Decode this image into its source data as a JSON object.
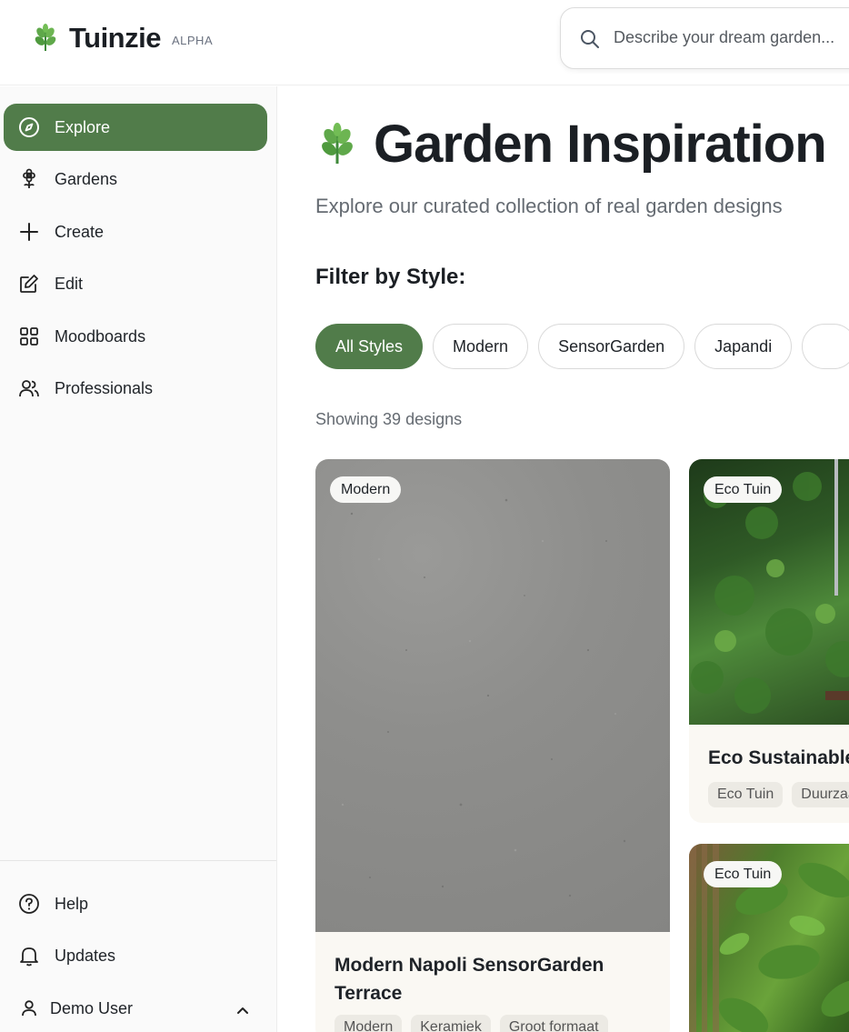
{
  "app": {
    "name": "Tuinzie",
    "badge": "ALPHA"
  },
  "search": {
    "placeholder": "Describe your dream garden..."
  },
  "sidebar": {
    "items": [
      {
        "label": "Explore",
        "icon": "compass-icon",
        "active": true
      },
      {
        "label": "Gardens",
        "icon": "flower-icon"
      },
      {
        "label": "Create",
        "icon": "plus-icon"
      },
      {
        "label": "Edit",
        "icon": "edit-icon"
      },
      {
        "label": "Moodboards",
        "icon": "grid-icon"
      },
      {
        "label": "Professionals",
        "icon": "users-icon"
      }
    ],
    "bottom": [
      {
        "label": "Help",
        "icon": "help-icon"
      },
      {
        "label": "Updates",
        "icon": "bell-icon"
      },
      {
        "label": "Demo User",
        "icon": "user-icon"
      }
    ]
  },
  "main": {
    "title": "Garden Inspiration",
    "subtitle": "Explore our curated collection of real garden designs",
    "filter_label": "Filter by Style:",
    "chips": [
      "All Styles",
      "Modern",
      "SensorGarden",
      "Japandi",
      ""
    ],
    "count": "Showing 39 designs"
  },
  "cards": [
    {
      "badge": "Modern",
      "title": "Modern Napoli SensorGarden Terrace",
      "tags": [
        "Modern",
        "Keramiek",
        "Groot formaat"
      ]
    },
    {
      "badge": "Eco Tuin",
      "title": "Eco Sustainable",
      "tags": [
        "Eco Tuin",
        "Duurzaa"
      ]
    },
    {
      "badge": "Eco Tuin"
    }
  ],
  "colors": {
    "accent": "#517c4a",
    "leaf": "#5fa84a"
  }
}
